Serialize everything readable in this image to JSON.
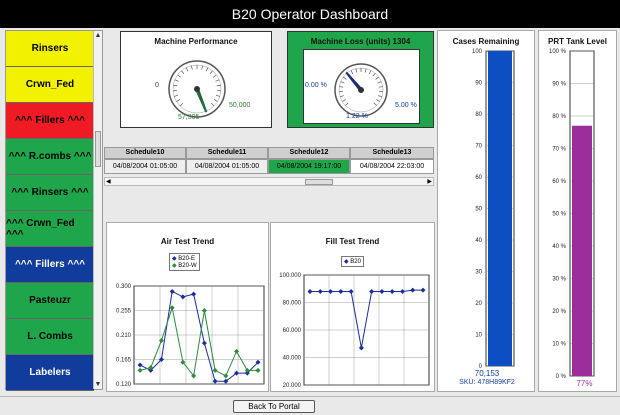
{
  "window": {
    "title": "B20 Operator Dashboard"
  },
  "colors": {
    "yellow": "#f2f200",
    "red": "#ee1b24",
    "green": "#20a64a",
    "blue": "#123c9c",
    "purple": "#9b2e9b",
    "case_blue": "#0d4fc3"
  },
  "sidebar": {
    "items": [
      {
        "label": "Rinsers",
        "color": "yellow"
      },
      {
        "label": "Crwn_Fed",
        "color": "yellow"
      },
      {
        "label": "^^^ Fillers ^^^",
        "color": "red"
      },
      {
        "label": "^^^ R.combs ^^^",
        "color": "green"
      },
      {
        "label": "^^^ Rinsers ^^^",
        "color": "green"
      },
      {
        "label": "^^^ Crwn_Fed ^^^",
        "color": "green"
      },
      {
        "label": "^^^ Fillers ^^^",
        "color": "blue"
      },
      {
        "label": "Pasteuzr",
        "color": "green"
      },
      {
        "label": "L. Combs",
        "color": "green"
      },
      {
        "label": "Labelers",
        "color": "blue"
      }
    ]
  },
  "machine_performance": {
    "title": "Machine Performance",
    "min_label": "0",
    "max_label": "50,000",
    "value_label": "57,305"
  },
  "machine_loss": {
    "title": "Machine Loss (units) 1304",
    "min_label": "0.00 %",
    "max_label": "5.00 %",
    "value_label": "1.22 %"
  },
  "schedule": {
    "columns": [
      {
        "name": "Schedule10",
        "time": "04/08/2004 01:05:00"
      },
      {
        "name": "Schedule11",
        "time": "04/08/2004 01:05:00"
      },
      {
        "name": "Schedule12",
        "time": "04/08/2004 19:17:00"
      },
      {
        "name": "Schedule13",
        "time": "04/08/2004 22:03:00"
      }
    ],
    "active_index": 2
  },
  "cases_remaining": {
    "title": "Cases Remaining",
    "value_label": "70,153",
    "sku": "SKU: 478H89KF2",
    "level": 1.0
  },
  "prt_tank": {
    "title": "PRT Tank Level",
    "value_label": "77%",
    "level": 0.77
  },
  "footer": {
    "back_button": "Back To Portal"
  },
  "chart_data": [
    {
      "type": "line",
      "title": "Air Test Trend",
      "ylim": [
        0.12,
        0.3
      ],
      "yticks": [
        "0.300",
        "0.255",
        "0.210",
        "0.165",
        "0.120"
      ],
      "series": [
        {
          "name": "B20-E",
          "color": "#1a2f9c",
          "marker": "diamond",
          "values": [
            0.155,
            0.145,
            0.165,
            0.29,
            0.28,
            0.285,
            0.195,
            0.125,
            0.125,
            0.14,
            0.14,
            0.16
          ]
        },
        {
          "name": "B20-W",
          "color": "#2e8b3e",
          "marker": "diamond",
          "values": [
            0.145,
            0.15,
            0.2,
            0.26,
            0.16,
            0.135,
            0.255,
            0.145,
            0.135,
            0.18,
            0.145,
            0.145
          ]
        }
      ]
    },
    {
      "type": "line",
      "title": "Fill Test Trend",
      "ylim": [
        20.0,
        100.0
      ],
      "yticks": [
        "100.000",
        "80.000",
        "60.000",
        "40.000",
        "20.000"
      ],
      "series": [
        {
          "name": "B20",
          "color": "#1a2f9c",
          "marker": "diamond",
          "values": [
            88,
            88,
            88,
            88,
            88,
            47,
            88,
            88,
            88,
            88,
            89,
            89
          ]
        }
      ]
    },
    {
      "type": "bar",
      "title": "Cases Remaining",
      "ylim": [
        0,
        100
      ],
      "yticks": [
        "100",
        "90",
        "80",
        "70",
        "60",
        "50",
        "40",
        "30",
        "20",
        "10",
        "0"
      ],
      "values": [
        100
      ]
    },
    {
      "type": "bar",
      "title": "PRT Tank Level",
      "ylim": [
        0,
        100
      ],
      "yticks": [
        "100 %",
        "90 %",
        "80 %",
        "70 %",
        "60 %",
        "50 %",
        "40 %",
        "30 %",
        "20 %",
        "10 %",
        "0 %"
      ],
      "values": [
        77
      ]
    }
  ]
}
